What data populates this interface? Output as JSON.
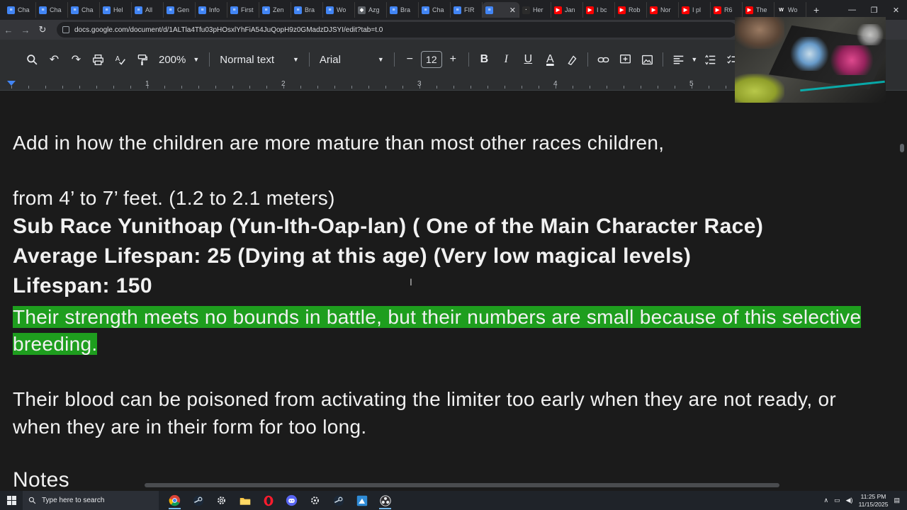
{
  "browser": {
    "tabs": [
      {
        "label": "Cha",
        "color": "#4285f4",
        "glyph": "≡"
      },
      {
        "label": "Cha",
        "color": "#4285f4",
        "glyph": "≡"
      },
      {
        "label": "Cha",
        "color": "#4285f4",
        "glyph": "≡"
      },
      {
        "label": "Hel",
        "color": "#4285f4",
        "glyph": "≡"
      },
      {
        "label": "All",
        "color": "#4285f4",
        "glyph": "≡"
      },
      {
        "label": "Gen",
        "color": "#4285f4",
        "glyph": "≡"
      },
      {
        "label": "Info",
        "color": "#4285f4",
        "glyph": "≡"
      },
      {
        "label": "First",
        "color": "#4285f4",
        "glyph": "≡"
      },
      {
        "label": "Zen",
        "color": "#4285f4",
        "glyph": "≡"
      },
      {
        "label": "Bra",
        "color": "#4285f4",
        "glyph": "≡"
      },
      {
        "label": "Wo",
        "color": "#4285f4",
        "glyph": "≡"
      },
      {
        "label": "Azg",
        "color": "#5f6368",
        "glyph": "◆"
      },
      {
        "label": "Bra",
        "color": "#4285f4",
        "glyph": "≡"
      },
      {
        "label": "Cha",
        "color": "#4285f4",
        "glyph": "≡"
      },
      {
        "label": "FIR",
        "color": "#4285f4",
        "glyph": "≡"
      },
      {
        "label": "",
        "color": "#4285f4",
        "glyph": "≡",
        "active": true
      },
      {
        "label": "Her",
        "color": "#2b2b2b",
        "glyph": "·"
      },
      {
        "label": "Jan",
        "color": "#ff0000",
        "glyph": "▶"
      },
      {
        "label": "I bc",
        "color": "#ff0000",
        "glyph": "▶"
      },
      {
        "label": "Rob",
        "color": "#ff0000",
        "glyph": "▶"
      },
      {
        "label": "Nor",
        "color": "#ff0000",
        "glyph": "▶"
      },
      {
        "label": "I pl",
        "color": "#ff0000",
        "glyph": "▶"
      },
      {
        "label": "R6",
        "color": "#ff0000",
        "glyph": "▶"
      },
      {
        "label": "The",
        "color": "#ff0000",
        "glyph": "▶"
      },
      {
        "label": "Wo",
        "color": "#202124",
        "glyph": "W"
      }
    ],
    "url": "docs.google.com/document/d/1ALTla4Tfu03pHOsxlYhFiA54JuQopH9z0GMadzDJSYI/edit?tab=t.0"
  },
  "toolbar": {
    "zoom": "200%",
    "style": "Normal text",
    "font": "Arial",
    "font_size": "12"
  },
  "ruler": {
    "numbers": [
      "1",
      "2",
      "3",
      "4",
      "5"
    ]
  },
  "document": {
    "line1": "Add in how the children are more mature than most other races children,",
    "line2": "from 4’ to 7’ feet. (1.2 to 2.1 meters)",
    "line3": "Sub Race Yunithoap (Yun-Ith-Oap-lan) ( One of the Main Character Race)",
    "line4": "Average Lifespan: 25 (Dying at this age) (Very low magical levels)",
    "line5": "Lifespan: 150",
    "highlighted": "Their strength meets no bounds in battle, but their numbers are small because of this selective breeding.",
    "paragraph": " Their blood can be poisoned from activating the limiter too early when they are not ready, or when they are in their form for too long.",
    "cut_heading": "Notes",
    "highlight_color": "#1e9e1e"
  },
  "taskbar": {
    "search_placeholder": "Type here to search",
    "time": "11:25 PM",
    "date": "11/15/2025"
  }
}
